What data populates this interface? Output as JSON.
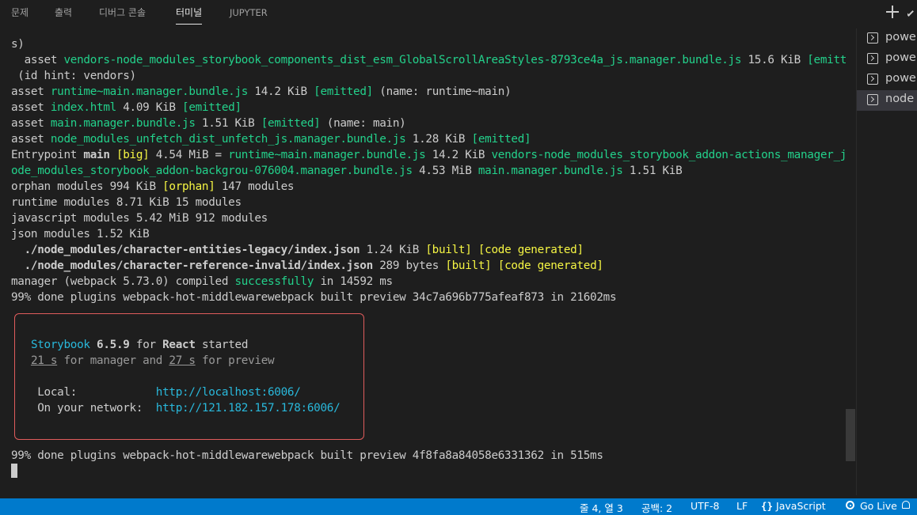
{
  "tabs": [
    "문제",
    "출력",
    "디버그 콘솔",
    "터미널",
    "JUPYTER"
  ],
  "active_tab": "터미널",
  "terminal": {
    "lines": [
      [
        {
          "t": "s)"
        }
      ],
      [
        {
          "t": "  asset "
        },
        {
          "t": "vendors-node_modules_storybook_components_dist_esm_GlobalScrollAreaStyles-8793ce4a_js.manager.bundle.js",
          "c": "g"
        },
        {
          "t": " 15.6 KiB "
        },
        {
          "t": "[emitted]",
          "c": "g"
        }
      ],
      [
        {
          "t": " (id hint: vendors)"
        }
      ],
      [
        {
          "t": "asset "
        },
        {
          "t": "runtime~main.manager.bundle.js",
          "c": "g"
        },
        {
          "t": " 14.2 KiB "
        },
        {
          "t": "[emitted]",
          "c": "g"
        },
        {
          "t": " (name: runtime~main)"
        }
      ],
      [
        {
          "t": "asset "
        },
        {
          "t": "index.html",
          "c": "g"
        },
        {
          "t": " 4.09 KiB "
        },
        {
          "t": "[emitted]",
          "c": "g"
        }
      ],
      [
        {
          "t": "asset "
        },
        {
          "t": "main.manager.bundle.js",
          "c": "g"
        },
        {
          "t": " 1.51 KiB "
        },
        {
          "t": "[emitted]",
          "c": "g"
        },
        {
          "t": " (name: main)"
        }
      ],
      [
        {
          "t": "asset "
        },
        {
          "t": "node_modules_unfetch_dist_unfetch_js.manager.bundle.js",
          "c": "g"
        },
        {
          "t": " 1.28 KiB "
        },
        {
          "t": "[emitted]",
          "c": "g"
        }
      ],
      [
        {
          "t": "Entrypoint "
        },
        {
          "t": "main",
          "c": "b"
        },
        {
          "t": " "
        },
        {
          "t": "[big]",
          "c": "y"
        },
        {
          "t": " 4.54 MiB = "
        },
        {
          "t": "runtime~main.manager.bundle.js",
          "c": "g"
        },
        {
          "t": " 14.2 KiB "
        },
        {
          "t": "vendors-node_modules_storybook_addon-actions_manager_js-n",
          "c": "g"
        }
      ],
      [
        {
          "t": "ode_modules_storybook_addon-backgrou-076004.manager.bundle.js",
          "c": "g"
        },
        {
          "t": " 4.53 MiB "
        },
        {
          "t": "main.manager.bundle.js",
          "c": "g"
        },
        {
          "t": " 1.51 KiB"
        }
      ],
      [
        {
          "t": "orphan modules 994 KiB "
        },
        {
          "t": "[orphan]",
          "c": "y"
        },
        {
          "t": " 147 modules"
        }
      ],
      [
        {
          "t": "runtime modules 8.71 KiB 15 modules"
        }
      ],
      [
        {
          "t": "javascript modules 5.42 MiB 912 modules"
        }
      ],
      [
        {
          "t": "json modules 1.52 KiB"
        }
      ],
      [
        {
          "t": "  ./node_modules/character-entities-legacy/index.json",
          "c": "b"
        },
        {
          "t": " 1.24 KiB "
        },
        {
          "t": "[built]",
          "c": "y"
        },
        {
          "t": " "
        },
        {
          "t": "[code generated]",
          "c": "y"
        }
      ],
      [
        {
          "t": "  ./node_modules/character-reference-invalid/index.json",
          "c": "b"
        },
        {
          "t": " 289 bytes "
        },
        {
          "t": "[built]",
          "c": "y"
        },
        {
          "t": " "
        },
        {
          "t": "[code generated]",
          "c": "y"
        }
      ],
      [
        {
          "t": "manager (webpack 5.73.0) compiled "
        },
        {
          "t": "successfully",
          "c": "g"
        },
        {
          "t": " in 14592 ms"
        }
      ],
      [
        {
          "t": "99% done plugins webpack-hot-middlewarewebpack built preview 34c7a696b775afeaf873 in 21602ms"
        }
      ],
      [],
      [],
      [
        {
          "t": "   "
        },
        {
          "t": "Storybook",
          "c": "c"
        },
        {
          "t": " "
        },
        {
          "t": "6.5.9",
          "c": "b"
        },
        {
          "t": " for "
        },
        {
          "t": "React",
          "c": "b"
        },
        {
          "t": " started"
        }
      ],
      [
        {
          "t": "   "
        },
        {
          "t": "21 s",
          "c": "grey u"
        },
        {
          "t": " for manager and ",
          "c": "grey"
        },
        {
          "t": "27 s",
          "c": "grey u"
        },
        {
          "t": " for preview",
          "c": "grey"
        }
      ],
      [],
      [
        {
          "t": "    Local:            "
        },
        {
          "t": "http://localhost:6006/",
          "c": "c"
        }
      ],
      [
        {
          "t": "    On your network:  "
        },
        {
          "t": "http://121.182.157.178:6006/",
          "c": "c"
        }
      ],
      [],
      [],
      [
        {
          "t": "99% done plugins webpack-hot-middlewarewebpack built preview 4f8fa8a84058e6331362 in 515ms"
        }
      ]
    ]
  },
  "side_panel": {
    "items": [
      {
        "label": "power",
        "icon": "terminal-icon"
      },
      {
        "label": "power",
        "icon": "terminal-icon"
      },
      {
        "label": "power",
        "icon": "terminal-icon"
      },
      {
        "label": "node",
        "icon": "terminal-icon",
        "active": true
      }
    ]
  },
  "status": {
    "position": "줄 4, 열 3",
    "spaces": "공백: 2",
    "encoding": "UTF-8",
    "eol": "LF",
    "language": "JavaScript",
    "golive": "Go Live"
  }
}
